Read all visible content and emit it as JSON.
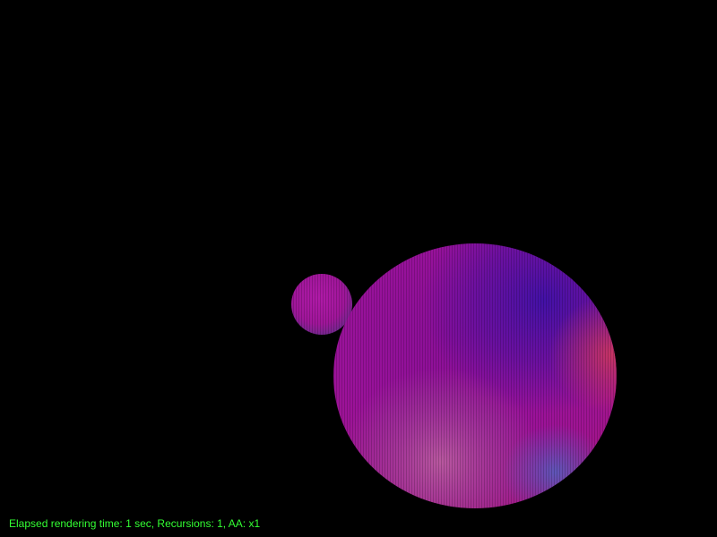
{
  "scene": {
    "background_color": "#000000",
    "objects": [
      {
        "name": "small-sphere",
        "color_primary": "#a0169a",
        "color_secondary": "#6a2a8a"
      },
      {
        "name": "large-sphere",
        "color_primary": "#9a0f9a",
        "color_secondary": "#3e11a8",
        "color_rim": "#c0306a"
      }
    ]
  },
  "status": {
    "text": "Elapsed rendering time: 1 sec, Recursions: 1, AA: x1",
    "color": "#33ff33"
  }
}
